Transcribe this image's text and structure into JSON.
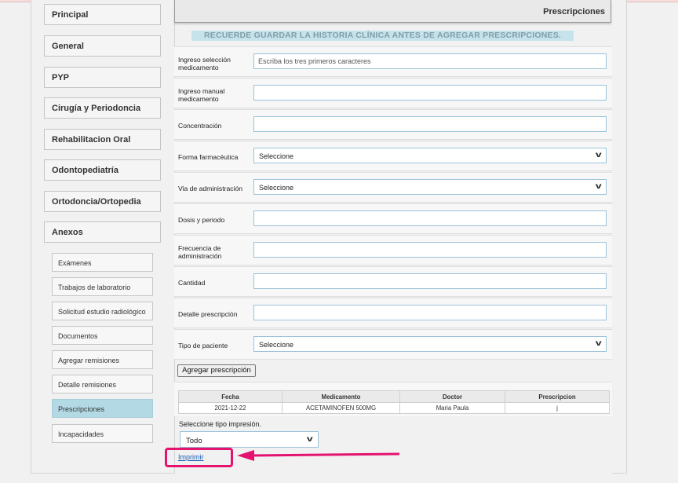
{
  "sidebar": {
    "items": [
      {
        "label": "Principal"
      },
      {
        "label": "General"
      },
      {
        "label": "PYP"
      },
      {
        "label": "Cirugía y Periodoncia"
      },
      {
        "label": "Rehabilitacion Oral"
      },
      {
        "label": "Odontopediatría"
      },
      {
        "label": "Ortodoncia/Ortopedia"
      },
      {
        "label": "Anexos"
      }
    ],
    "sub_items": [
      {
        "label": "Exámenes"
      },
      {
        "label": "Trabajos de laboratorio"
      },
      {
        "label": "Solicitud estudio radiológico"
      },
      {
        "label": "Documentos"
      },
      {
        "label": "Agregar remisiones"
      },
      {
        "label": "Detalle remisiones"
      },
      {
        "label": "Prescripciones",
        "active": true
      },
      {
        "label": "Incapacidades"
      }
    ]
  },
  "panel": {
    "title": "Prescripciones",
    "notice": "RECUERDE GUARDAR LA HISTORIA CLÍNICA ANTES DE AGREGAR PRESCRIPCIONES."
  },
  "form": {
    "med_search": {
      "label": "Ingreso selección medicamento",
      "placeholder": "Escriba los tres primeros caracteres",
      "value": ""
    },
    "med_manual": {
      "label": "Ingreso manual medicamento",
      "value": ""
    },
    "concentration": {
      "label": "Concentración",
      "value": ""
    },
    "pharma_form": {
      "label": "Forma farmacéutica",
      "selected": "Seleccione"
    },
    "route": {
      "label": "Via de administración",
      "selected": "Seleccione"
    },
    "dose": {
      "label": "Dosis y periodo",
      "value": ""
    },
    "frequency": {
      "label": "Frecuencia de administración",
      "value": ""
    },
    "quantity": {
      "label": "Cantidad",
      "value": ""
    },
    "detail": {
      "label": "Detalle prescripción",
      "value": ""
    },
    "patient_type": {
      "label": "Tipo de paciente",
      "selected": "Seleccione"
    },
    "add_button": "Agregar prescripción"
  },
  "table": {
    "headers": [
      "Fecha",
      "Medicamento",
      "Doctor",
      "Prescripcion"
    ],
    "rows": [
      [
        "2021-12-22",
        "ACETAMINOFEN 500MG",
        "Maria Paula",
        "j"
      ]
    ]
  },
  "print": {
    "label": "Seleccione tipo impresión.",
    "selected": "Todo",
    "link": "Imprimir"
  },
  "colors": {
    "active_tab": "#b3dae4",
    "notice_bg": "#c6e3ec",
    "annotation": "#e4136f",
    "link": "#1a5fb4"
  },
  "icons": {
    "select_caret": "chevron-down-icon",
    "annotation_arrow": "arrow-left-icon"
  }
}
